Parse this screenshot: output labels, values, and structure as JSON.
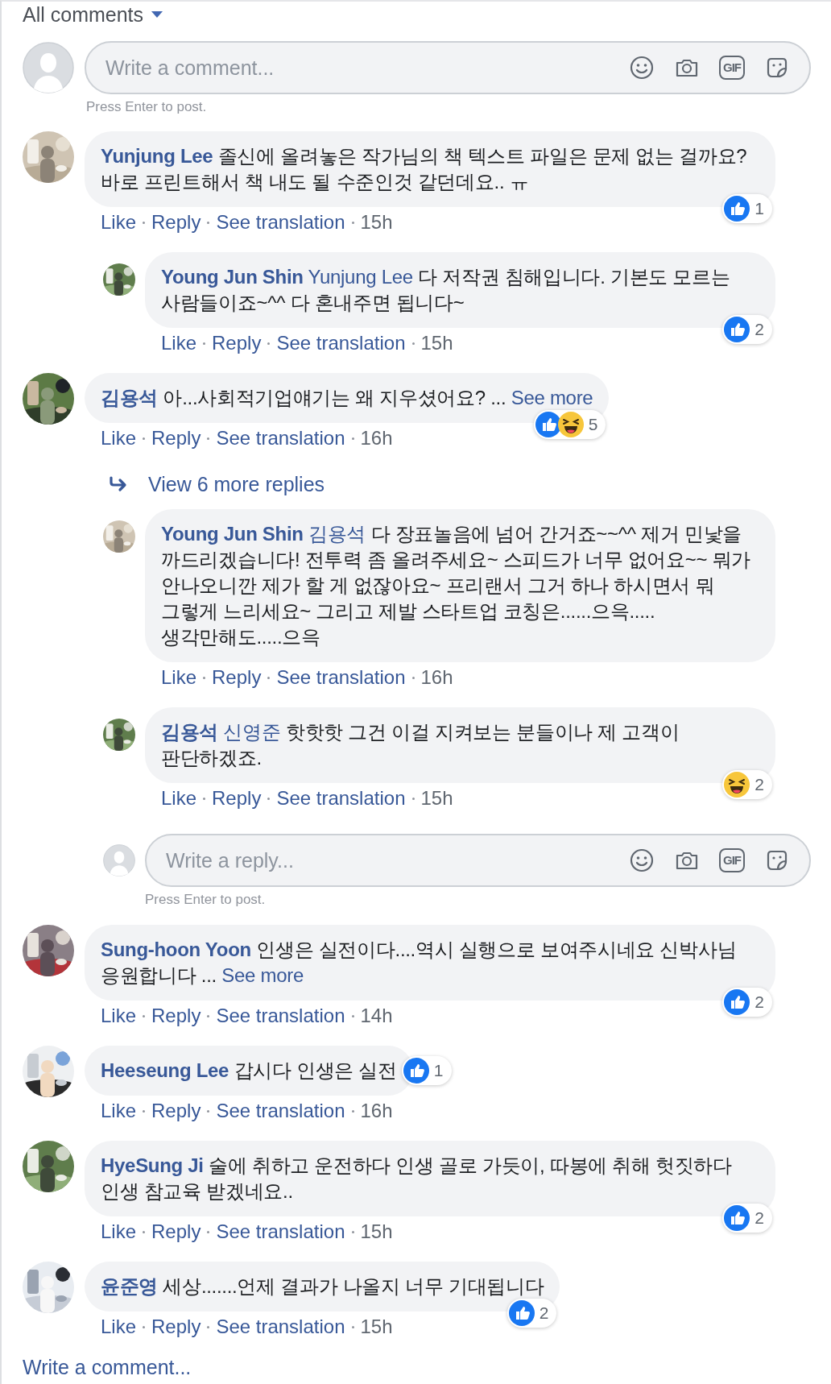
{
  "header": {
    "title": "All comments"
  },
  "composer": {
    "placeholder": "Write a comment...",
    "gif_label": "GIF",
    "hint": "Press Enter to post."
  },
  "comments": [
    {
      "author": "Yunjung Lee",
      "text": "졸신에 올려놓은 작가님의 책 텍스트 파일은 문제 없는 걸까요? 바로 프린트해서 책 내도 될 수준인것 같던데요.. ㅠ",
      "actions": [
        "Like",
        "Reply",
        "See translation"
      ],
      "time": "15h",
      "reactions": {
        "icons": [
          {
            "kind": "like"
          }
        ],
        "count": "1"
      },
      "replies": [
        {
          "author": "Young Jun Shin",
          "mention": "Yunjung Lee",
          "text": "다 저작권 침해입니다. 기본도 모르는 사람들이죠~^^ 다 혼내주면 됩니다~",
          "actions": [
            "Like",
            "Reply",
            "See translation"
          ],
          "time": "15h",
          "reactions": {
            "icons": [
              {
                "kind": "like"
              }
            ],
            "count": "2"
          }
        }
      ]
    },
    {
      "author": "김용석",
      "text": "아...사회적기업얘기는 왜 지우셨어요? ...",
      "see_more": "See more",
      "actions": [
        "Like",
        "Reply",
        "See translation"
      ],
      "time": "16h",
      "reactions": {
        "icons": [
          {
            "kind": "like"
          },
          {
            "kind": "haha"
          }
        ],
        "count": "5"
      },
      "view_more_replies": "View 6 more replies",
      "replies": [
        {
          "author": "Young Jun Shin",
          "mention": "김용석",
          "text": "다 장표놀음에 넘어 간거죠~~^^ 제거 민낯을 까드리겠습니다! 전투력 좀 올려주세요~ 스피드가 너무 없어요~~ 뭐가 안나오니깐 제가 할 게 없잖아요~ 프리랜서 그거 하나 하시면서 뭐 그렇게 느리세요~ 그리고 제발 스타트업 코칭은......으윽..... 생각만해도.....으윽",
          "actions": [
            "Like",
            "Reply",
            "See translation"
          ],
          "time": "16h"
        },
        {
          "author": "김용석",
          "mention": "신영준",
          "text": "핫핫핫 그건 이걸 지켜보는 분들이나 제 고객이 판단하겠죠.",
          "actions": [
            "Like",
            "Reply",
            "See translation"
          ],
          "time": "15h",
          "reactions": {
            "icons": [
              {
                "kind": "haha"
              }
            ],
            "count": "2"
          }
        }
      ],
      "reply_composer": {
        "placeholder": "Write a reply...",
        "gif_label": "GIF",
        "hint": "Press Enter to post."
      }
    },
    {
      "author": "Sung-hoon Yoon",
      "text": "인생은 실전이다....역시 실행으로 보여주시네요 신박사님 응원합니다 ...",
      "see_more": "See more",
      "actions": [
        "Like",
        "Reply",
        "See translation"
      ],
      "time": "14h",
      "reactions": {
        "icons": [
          {
            "kind": "like"
          }
        ],
        "count": "2"
      }
    },
    {
      "author": "Heeseung Lee",
      "text": "갑시다 인생은 실전",
      "actions": [
        "Like",
        "Reply",
        "See translation"
      ],
      "time": "16h",
      "reactions": {
        "icons": [
          {
            "kind": "like"
          }
        ],
        "count": "1"
      }
    },
    {
      "author": "HyeSung Ji",
      "text": "술에 취하고 운전하다 인생 골로 가듯이, 따봉에 취해 헛짓하다 인생 참교육 받겠네요..",
      "actions": [
        "Like",
        "Reply",
        "See translation"
      ],
      "time": "15h",
      "reactions": {
        "icons": [
          {
            "kind": "like"
          }
        ],
        "count": "2"
      }
    },
    {
      "author": "윤준영",
      "text": "세상.......언제 결과가 나올지 너무 기대됩니다",
      "actions": [
        "Like",
        "Reply",
        "See translation"
      ],
      "time": "15h",
      "reactions": {
        "icons": [
          {
            "kind": "like"
          }
        ],
        "count": "2"
      }
    }
  ],
  "footer": {
    "link": "Write a comment..."
  }
}
